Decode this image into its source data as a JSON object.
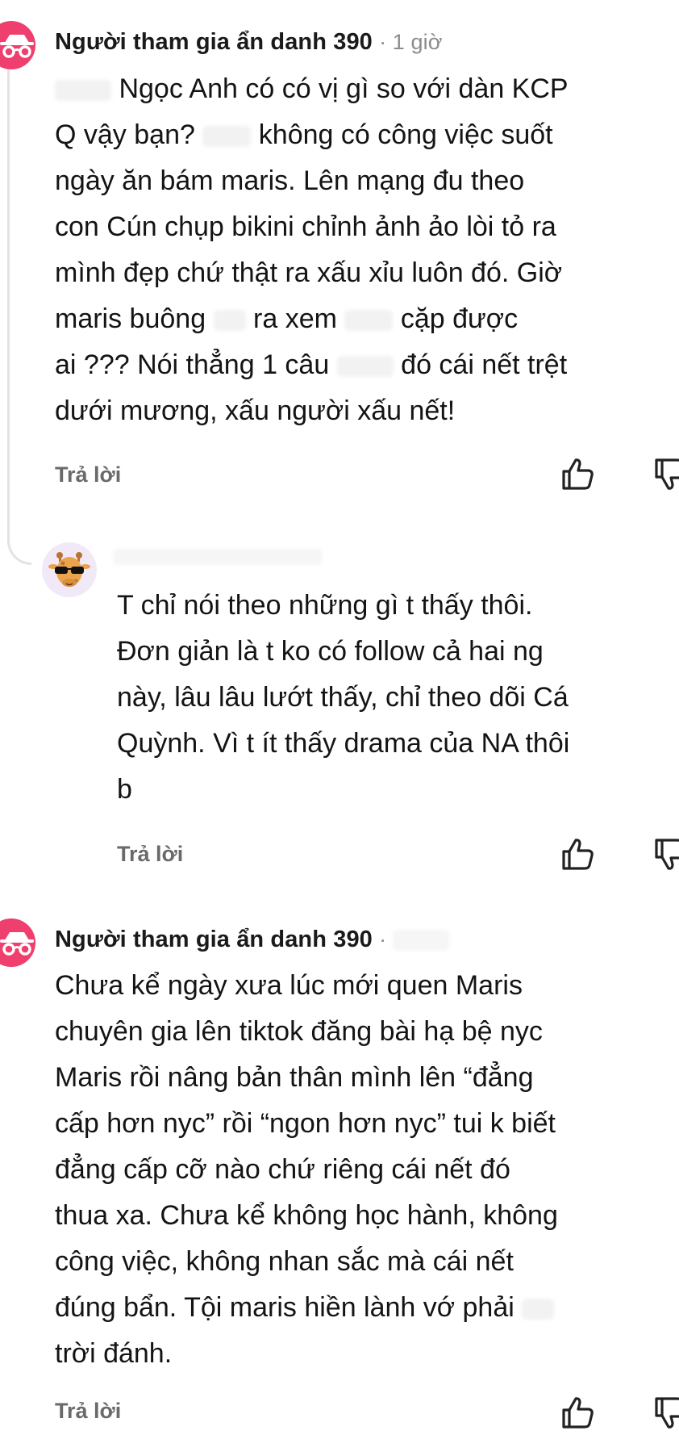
{
  "comments": [
    {
      "author": "Người tham gia ẩn danh 390",
      "time": "· 1 giờ",
      "lines": [
        "Ngọc Anh có có vị gì so với dàn KCP",
        "Q vậy bạn?",
        "không có công việc suốt",
        "ngày ăn bám maris. Lên mạng đu theo",
        "con Cún chụp bikini chỉnh ảnh ảo lòi tỏ ra",
        "mình đẹp chứ thật ra xấu xỉu luôn đó. Giờ",
        "maris buông",
        "ra xem",
        "cặp được",
        "ai ??? Nói thẳng 1 câu",
        "đó cái nết trệt",
        "dưới mương, xấu người xấu nết!"
      ],
      "reply_label": "Trả lời"
    },
    {
      "lines": [
        "T chỉ nói theo những gì t thấy thôi.",
        "Đơn giản là t ko có follow cả hai ng",
        "này, lâu lâu lướt thấy, chỉ theo dõi Cá",
        "Quỳnh. Vì t ít thấy drama của NA thôi",
        "b"
      ],
      "reply_label": "Trả lời"
    },
    {
      "author": "Người tham gia ẩn danh 390",
      "time": "·",
      "lines": [
        "Chưa kể ngày xưa lúc mới quen Maris",
        "chuyên gia lên tiktok đăng bài hạ bệ nyc",
        "Maris rồi nâng bản thân mình lên “đẳng",
        "cấp hơn nyc” rồi “ngon hơn nyc” tui k biết",
        "đẳng cấp cỡ nào chứ riêng cái nết đó",
        "thua xa. Chưa kể không học hành, không",
        "công việc, không nhan sắc mà cái nết",
        "đúng bẩn. Tội maris hiền lành vớ phải",
        "trời đánh."
      ],
      "reply_label": "Trả lời"
    }
  ],
  "icons": {
    "anonymous_avatar": "incognito-icon",
    "giraffe_avatar": "giraffe-sunglasses-avatar",
    "like": "thumbs-up-icon",
    "dislike": "thumbs-down-icon"
  },
  "colors": {
    "anonymous_avatar_bg": "#ef3f6f",
    "meta_text": "#8c8c8c",
    "reply_text": "#6a6a6a"
  }
}
